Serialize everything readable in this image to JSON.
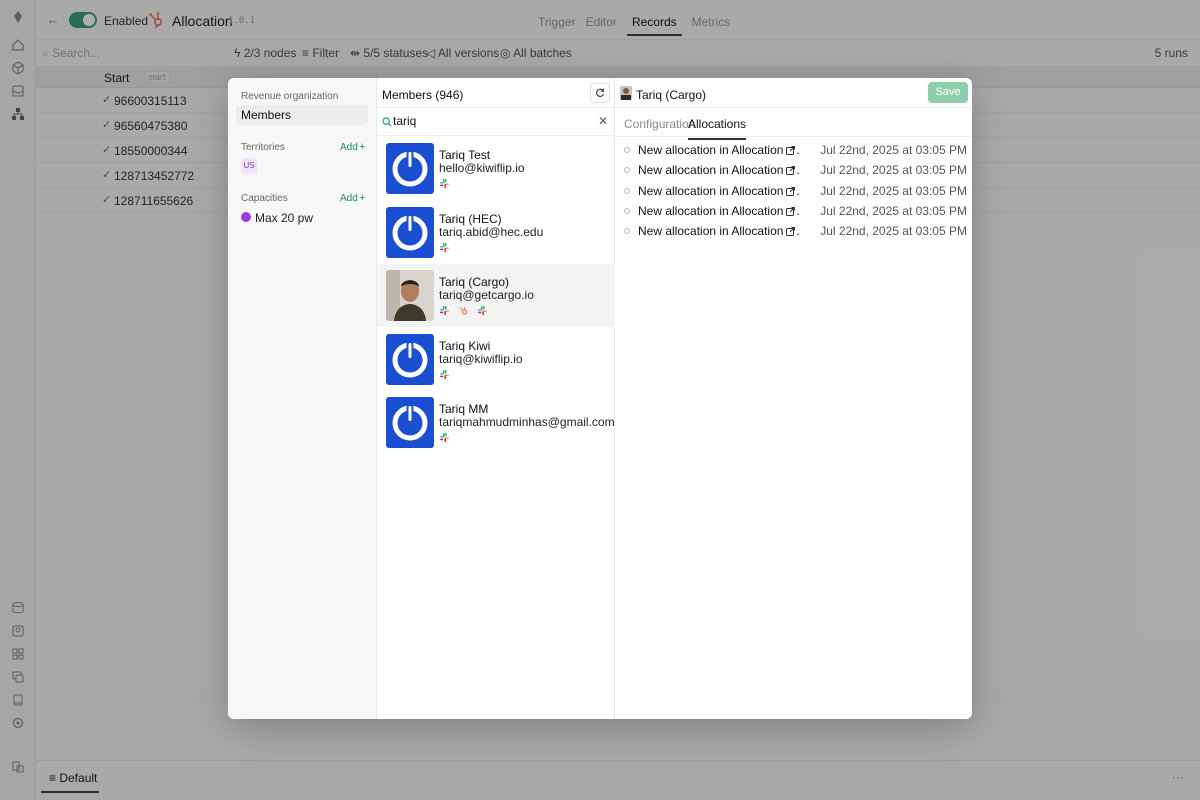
{
  "app": {
    "enabled_label": "Enabled",
    "workflow_title": "Allocation",
    "version": "1.0.1",
    "tabs": [
      "Trigger",
      "Editor",
      "Records",
      "Metrics"
    ],
    "active_tab": "Records",
    "search_placeholder": "Search...",
    "filters": {
      "nodes": "2/3 nodes",
      "filter": "Filter",
      "statuses": "5/5 statuses",
      "versions": "All versions",
      "batches": "All batches"
    },
    "runs": "5 runs",
    "grid_header": {
      "start": "Start",
      "start_tag": "start"
    },
    "rows": [
      "96600315113",
      "96560475380",
      "18550000344",
      "128713452772",
      "128711655626"
    ],
    "bottom_tab": "Default"
  },
  "modal": {
    "sidebar": {
      "section_org": "Revenue organization",
      "members_item": "Members",
      "territories_label": "Territories",
      "territories_add": "Add",
      "territory_badge": "US",
      "capacities_label": "Capacities",
      "capacities_add": "Add",
      "capacity_item": "Max 20 pw",
      "capacity_color": "#9d3be0"
    },
    "members": {
      "title": "Members (946)",
      "search_value": "tariq",
      "list": [
        {
          "name": "Tariq Test",
          "email": "hello@kiwiflip.io",
          "icons": [
            "slack-icon"
          ]
        },
        {
          "name": "Tariq (HEC)",
          "email": "tariq.abid@hec.edu",
          "icons": [
            "slack-icon"
          ]
        },
        {
          "name": "Tariq (Cargo)",
          "email": "tariq@getcargo.io",
          "icons": [
            "slack-icon",
            "hubspot-icon",
            "slack-icon"
          ],
          "selected": true
        },
        {
          "name": "Tariq Kiwi",
          "email": "tariq@kiwiflip.io",
          "icons": [
            "slack-icon"
          ]
        },
        {
          "name": "Tariq MM",
          "email": "tariqmahmudminhas@gmail.com",
          "icons": [
            "slack-icon"
          ]
        }
      ]
    },
    "detail": {
      "title": "Tariq (Cargo)",
      "save_label": "Save",
      "tabs": [
        "Configuration",
        "Allocations"
      ],
      "active_tab": "Allocations",
      "allocations": [
        {
          "prefix": "New allocation in ",
          "target": "Allocation",
          "suffix": ".",
          "time": "Jul 22nd, 2025 at 03:05 PM"
        },
        {
          "prefix": "New allocation in ",
          "target": "Allocation",
          "suffix": ".",
          "time": "Jul 22nd, 2025 at 03:05 PM"
        },
        {
          "prefix": "New allocation in ",
          "target": "Allocation",
          "suffix": ".",
          "time": "Jul 22nd, 2025 at 03:05 PM"
        },
        {
          "prefix": "New allocation in ",
          "target": "Allocation",
          "suffix": ".",
          "time": "Jul 22nd, 2025 at 03:05 PM"
        },
        {
          "prefix": "New allocation in ",
          "target": "Allocation",
          "suffix": ".",
          "time": "Jul 22nd, 2025 at 03:05 PM"
        }
      ]
    }
  },
  "colors": {
    "accent_green": "#1f8a5b",
    "save_button": "#8fcfae",
    "avatar_blue": "#1b4fd1"
  }
}
